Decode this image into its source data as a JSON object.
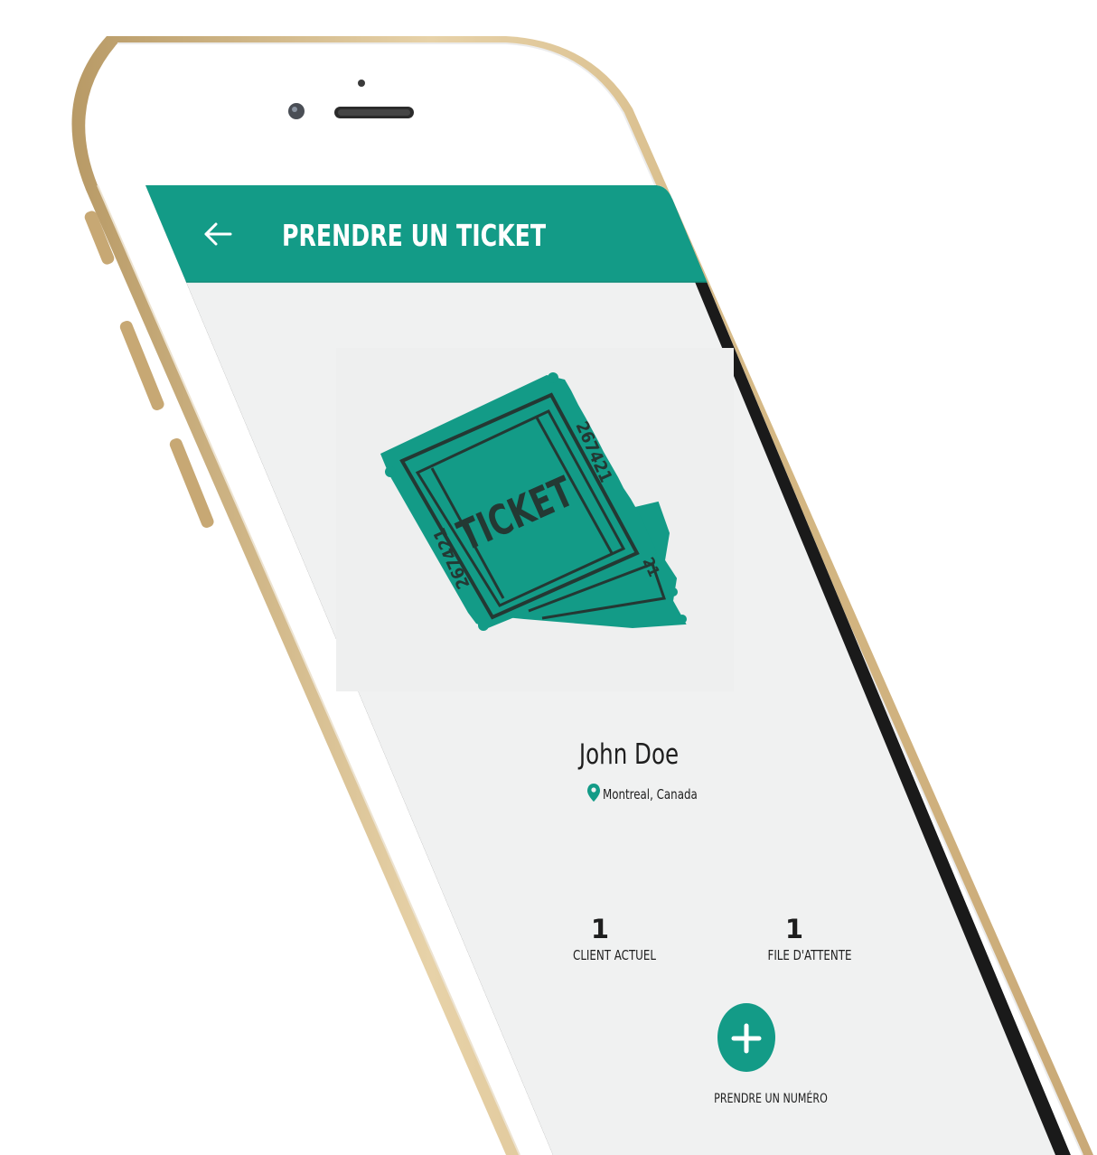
{
  "app_bar": {
    "title": "PRENDRE UN TICKET",
    "back_icon": "arrow-left-icon"
  },
  "ticket_image": {
    "label": "TICKET",
    "serial_left": "267421",
    "serial_right": "267421",
    "serial_stub": "21"
  },
  "profile": {
    "name": "John Doe",
    "location": "Montreal, Canada",
    "location_icon": "map-pin-icon"
  },
  "stats": [
    {
      "value": "1",
      "label": "CLIENT ACTUEL"
    },
    {
      "value": "1",
      "label": "FILE D'ATTENTE"
    }
  ],
  "action": {
    "label": "PRENDRE UN NUMÉRO",
    "icon": "plus-icon"
  },
  "colors": {
    "accent": "#139B87",
    "screen_bg": "#F0F1F1",
    "phone_gold": "#D8BE8E",
    "text_dark": "#1E1E1E"
  }
}
